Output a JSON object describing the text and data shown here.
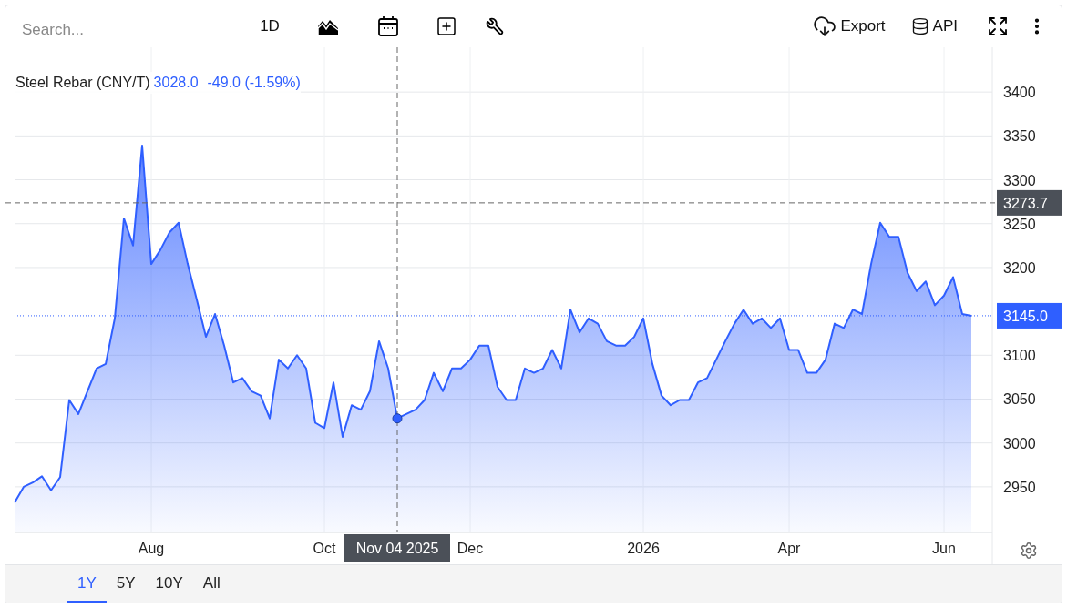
{
  "toolbar": {
    "search": {
      "placeholder": "Search..."
    },
    "interval": "1D",
    "actions": [
      {
        "label": "Export",
        "kind": "export"
      },
      {
        "label": "API",
        "kind": "api"
      }
    ]
  },
  "legend": {
    "value": "3028.0",
    "change": "-49.0 (-1.59%)"
  },
  "chart_data": {
    "type": "area",
    "title": "Steel Rebar (CNY/T)",
    "grid": true,
    "ylim": [
      2898,
      3451
    ],
    "categories": [
      null,
      null,
      null,
      null,
      null,
      null,
      null,
      null,
      null,
      null,
      null,
      null,
      null,
      null,
      null,
      "Aug",
      null,
      null,
      null,
      null,
      null,
      null,
      null,
      null,
      null,
      null,
      null,
      null,
      null,
      null,
      null,
      null,
      null,
      null,
      "Oct",
      null,
      null,
      null,
      null,
      null,
      null,
      null,
      null,
      null,
      null,
      null,
      null,
      null,
      null,
      null,
      "Dec",
      null,
      null,
      null,
      null,
      null,
      null,
      null,
      null,
      null,
      null,
      null,
      null,
      null,
      null,
      null,
      null,
      null,
      null,
      "2026",
      null,
      null,
      null,
      null,
      null,
      null,
      null,
      null,
      null,
      null,
      null,
      null,
      null,
      null,
      null,
      "Apr",
      null,
      null,
      null,
      null,
      null,
      null,
      null,
      null,
      null,
      null,
      null,
      null,
      null,
      null,
      null,
      null,
      "Jun",
      null,
      null,
      null
    ],
    "yticks": [
      2950,
      3000,
      3050,
      3100,
      3200,
      3250,
      3300,
      3350,
      3400
    ],
    "series": [
      {
        "color": "#2f5fff",
        "values": [
          2932,
          2950,
          2955,
          2962,
          2946,
          2961,
          3049,
          3033,
          3059,
          3085,
          3090,
          3142,
          3256,
          3225,
          3339,
          3204,
          3220,
          3240,
          3251,
          3204,
          3163,
          3121,
          3147,
          3111,
          3069,
          3074,
          3059,
          3054,
          3028,
          3095,
          3085,
          3100,
          3085,
          3023,
          3017,
          3069,
          3007,
          3043,
          3038,
          3059,
          3116,
          3085,
          3028,
          3033,
          3038,
          3049,
          3080,
          3059,
          3085,
          3085,
          3095,
          3111,
          3111,
          3064,
          3049,
          3049,
          3085,
          3080,
          3085,
          3106,
          3085,
          3152,
          3126,
          3142,
          3136,
          3116,
          3111,
          3111,
          3121,
          3142,
          3090,
          3054,
          3043,
          3049,
          3049,
          3069,
          3074,
          3095,
          3116,
          3136,
          3152,
          3136,
          3142,
          3131,
          3142,
          3106,
          3106,
          3080,
          3080,
          3095,
          3136,
          3131,
          3152,
          3147,
          3204,
          3251,
          3235,
          3235,
          3194,
          3173,
          3184,
          3157,
          3168,
          3189,
          3147,
          3145
        ]
      }
    ],
    "ref_lines": [
      {
        "axis": "y",
        "value": 3273.7,
        "label": "3273.7"
      },
      {
        "axis": "y",
        "value": 3145,
        "label": "3145.0"
      }
    ]
  },
  "crosshair": {
    "date": "Nov 04 2025"
  },
  "ranges": [
    {
      "label": "1Y",
      "selected": true
    },
    {
      "label": "5Y",
      "selected": false
    },
    {
      "label": "10Y",
      "selected": false
    },
    {
      "label": "All",
      "selected": false
    }
  ]
}
